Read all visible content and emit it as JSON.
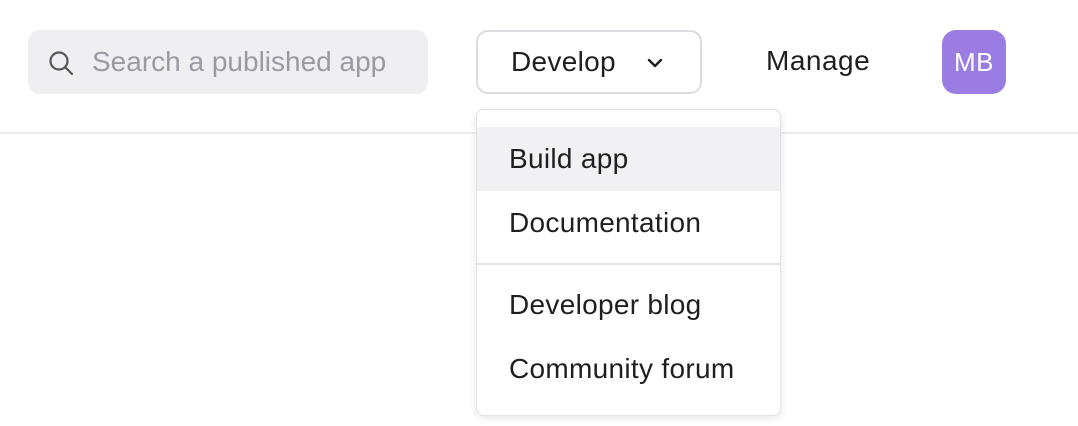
{
  "search": {
    "placeholder": "Search a published app",
    "icon": "search-icon"
  },
  "nav": {
    "develop_label": "Develop",
    "develop_icon": "chevron-down-icon",
    "manage_label": "Manage"
  },
  "user": {
    "initials": "MB",
    "avatar_color": "#9b7ce3"
  },
  "develop_menu": {
    "items": [
      {
        "label": "Build app",
        "active": true
      },
      {
        "label": "Documentation",
        "active": false
      },
      {
        "label": "Developer blog",
        "active": false
      },
      {
        "label": "Community forum",
        "active": false
      }
    ]
  }
}
